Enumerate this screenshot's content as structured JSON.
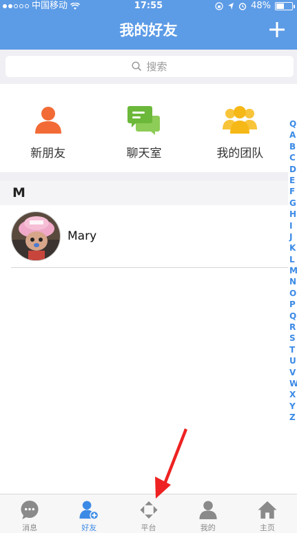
{
  "status": {
    "carrier": "中国移动",
    "time": "17:55",
    "battery": "48%",
    "battery_fraction": 0.48
  },
  "header": {
    "title": "我的好友",
    "add_icon": "plus-icon"
  },
  "search": {
    "placeholder": "搜索",
    "icon": "search-icon"
  },
  "quick_actions": [
    {
      "label": "新朋友",
      "icon": "person-icon",
      "color": "#f26b36"
    },
    {
      "label": "聊天室",
      "icon": "chat-bubbles-icon",
      "color": "#7cc14a"
    },
    {
      "label": "我的团队",
      "icon": "team-icon",
      "color": "#f6b816"
    }
  ],
  "section": {
    "letter": "M"
  },
  "contacts": [
    {
      "name": "Mary",
      "avatar": "avatar-image"
    }
  ],
  "index_letters": [
    "Q",
    "A",
    "B",
    "C",
    "D",
    "E",
    "F",
    "G",
    "H",
    "I",
    "J",
    "K",
    "L",
    "M",
    "N",
    "O",
    "P",
    "Q",
    "R",
    "S",
    "T",
    "U",
    "V",
    "W",
    "X",
    "Y",
    "Z"
  ],
  "tabs": [
    {
      "label": "消息",
      "icon": "message-icon",
      "active": false
    },
    {
      "label": "好友",
      "icon": "friends-icon",
      "active": true
    },
    {
      "label": "平台",
      "icon": "platform-icon",
      "active": false
    },
    {
      "label": "我的",
      "icon": "profile-icon",
      "active": false
    },
    {
      "label": "主页",
      "icon": "home-icon",
      "active": false
    }
  ],
  "colors": {
    "header_bg": "#5c9be6",
    "accent": "#3b8ae6",
    "annotation": "#ee2222"
  }
}
